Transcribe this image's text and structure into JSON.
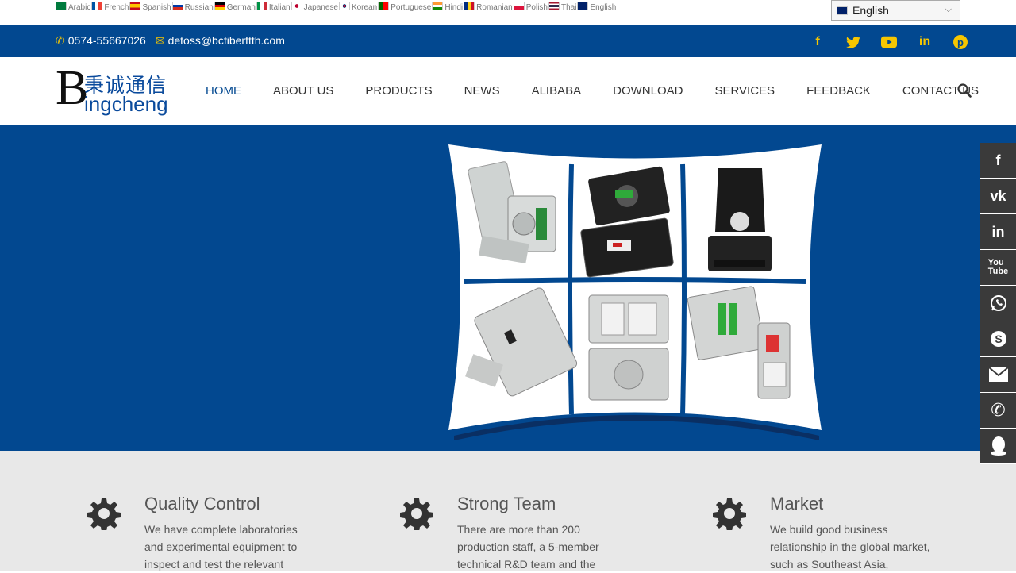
{
  "languages": [
    {
      "label": "Arabic",
      "colors": [
        "#007a3d",
        "#ffffff"
      ]
    },
    {
      "label": "French",
      "colors": [
        "#0055a4",
        "#ef4135"
      ]
    },
    {
      "label": "Spanish",
      "colors": [
        "#c60b1e",
        "#ffc400"
      ]
    },
    {
      "label": "Russian",
      "colors": [
        "#ffffff",
        "#0039a6"
      ]
    },
    {
      "label": "German",
      "colors": [
        "#000000",
        "#dd0000"
      ]
    },
    {
      "label": "Italian",
      "colors": [
        "#009246",
        "#ce2b37"
      ]
    },
    {
      "label": "Japanese",
      "colors": [
        "#ffffff",
        "#bc002d"
      ]
    },
    {
      "label": "Korean",
      "colors": [
        "#ffffff",
        "#003478"
      ]
    },
    {
      "label": "Portuguese",
      "colors": [
        "#006600",
        "#ff0000"
      ]
    },
    {
      "label": "Hindi",
      "colors": [
        "#ff9933",
        "#138808"
      ]
    },
    {
      "label": "Romanian",
      "colors": [
        "#002b7f",
        "#ce1126"
      ]
    },
    {
      "label": "Polish",
      "colors": [
        "#ffffff",
        "#dc143c"
      ]
    },
    {
      "label": "Thai",
      "colors": [
        "#a51931",
        "#2d2a4a"
      ]
    },
    {
      "label": "English",
      "colors": [
        "#012169",
        "#c8102e"
      ]
    }
  ],
  "language_select": {
    "value": "English"
  },
  "topbar": {
    "phone": "0574-55667026",
    "email": "detoss@bcfiberftth.com",
    "socials": [
      "facebook-icon",
      "twitter-icon",
      "youtube-icon",
      "linkedin-icon",
      "pinterest-icon"
    ]
  },
  "logo": {
    "cn_text": "秉诚通信",
    "en_text": "ingcheng",
    "big_letter": "B"
  },
  "nav": {
    "items": [
      "HOME",
      "ABOUT US",
      "PRODUCTS",
      "NEWS",
      "ALIBABA",
      "DOWNLOAD",
      "SERVICES",
      "FEEDBACK",
      "CONTACT US"
    ],
    "active": "HOME"
  },
  "features": [
    {
      "title": "Quality Control",
      "text": "We have complete laboratories and experimental equipment to inspect and test the relevant"
    },
    {
      "title": "Strong Team",
      "text": "There are more than 200 production staff, a 5-member technical R&D team and the"
    },
    {
      "title": "Market",
      "text": "We build good business relationship in the global market, such as Southeast Asia,"
    }
  ],
  "sidebar": [
    "facebook-icon",
    "vk-icon",
    "linkedin-icon",
    "youtube-icon",
    "whatsapp-icon",
    "skype-icon",
    "email-icon",
    "phone-icon",
    "qq-icon"
  ],
  "colors": {
    "primary": "#024890",
    "accent": "#f7c600",
    "sidebar": "#3a3a3a"
  }
}
